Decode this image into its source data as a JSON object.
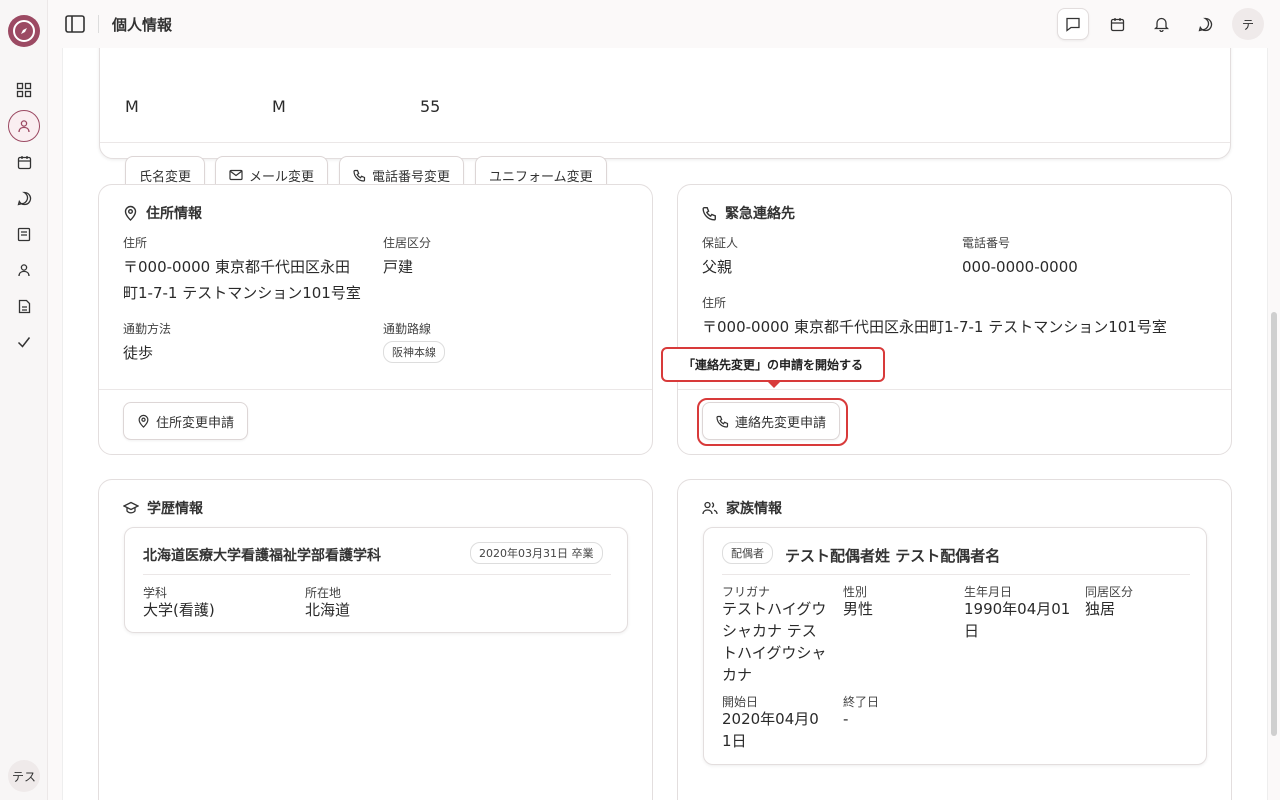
{
  "sidebar": {
    "items": [
      "dashboard-icon",
      "user-icon",
      "calendar-icon",
      "chat-icon",
      "book-icon",
      "person-icon",
      "document-icon",
      "check-icon"
    ],
    "avatar": "テス"
  },
  "topbar": {
    "title": "個人情報",
    "avatar": "テ"
  },
  "top_card": {
    "values": [
      "M",
      "M",
      "55"
    ],
    "buttons": [
      "氏名変更",
      "メール変更",
      "電話番号変更",
      "ユニフォーム変更"
    ]
  },
  "address": {
    "title": "住所情報",
    "address_label": "住所",
    "address_line1": "〒000-0000 東京都千代田区永田",
    "address_line2": "町1-7-1 テストマンション101号室",
    "housing_label": "住居区分",
    "housing_value": "戸建",
    "commute_label": "通勤方法",
    "commute_value": "徒歩",
    "route_label": "通勤路線",
    "route_value": "阪神本線",
    "button": "住所変更申請"
  },
  "emergency": {
    "title": "緊急連絡先",
    "guarantor_label": "保証人",
    "guarantor_value": "父親",
    "phone_label": "電話番号",
    "phone_value": "000-0000-0000",
    "address_label": "住所",
    "address_value": "〒000-0000 東京都千代田区永田町1-7-1 テストマンション101号室",
    "button": "連絡先変更申請",
    "tooltip": "「連絡先変更」の申請を開始する"
  },
  "education": {
    "title": "学歴情報",
    "school": "北海道医療大学看護福祉学部看護学科",
    "graduation": "2020年03月31日 卒業",
    "dept_label": "学科",
    "dept_value": "大学(看護)",
    "location_label": "所在地",
    "location_value": "北海道"
  },
  "family": {
    "title": "家族情報",
    "relation": "配偶者",
    "name": "テスト配偶者姓 テスト配偶者名",
    "furigana_label": "フリガナ",
    "furigana_lines": [
      "テストハイグウ",
      "シャカナ テス",
      "トハイグウシャ",
      "カナ"
    ],
    "gender_label": "性別",
    "gender_value": "男性",
    "birth_label": "生年月日",
    "birth_lines": [
      "1990年04月01",
      "日"
    ],
    "cohabit_label": "同居区分",
    "cohabit_value": "独居",
    "start_label": "開始日",
    "start_lines": [
      "2020年04月0",
      "1日"
    ],
    "end_label": "終了日",
    "end_value": "-"
  },
  "colors": {
    "brand": "#9c4a63",
    "highlight": "#d83a3a"
  }
}
